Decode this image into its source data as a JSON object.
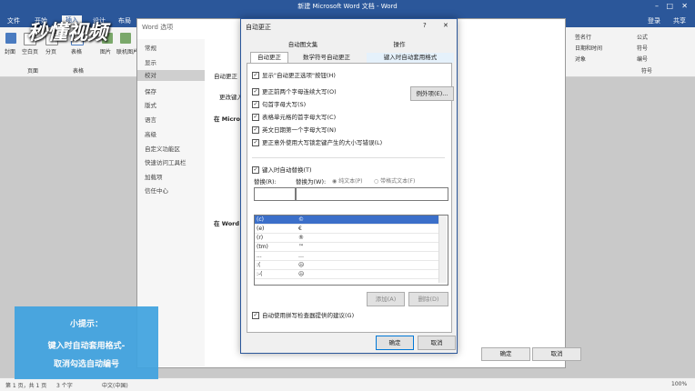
{
  "word": {
    "title": "新建 Microsoft Word 文档 - Word",
    "login": "登录",
    "share": "共享",
    "tabs": [
      "文件",
      "开始",
      "插入",
      "设计",
      "布局"
    ],
    "ribbon": {
      "groups": [
        "页面",
        "表格",
        "符号"
      ],
      "items": [
        "封面",
        "空白页",
        "分页",
        "表格",
        "图片",
        "联机图片"
      ],
      "right_items": [
        "签名行",
        "日期和时间",
        "对象",
        "公式",
        "符号",
        "编号"
      ],
      "status": [
        "第 1 页，共 1 页",
        "3 个字",
        "中文(中国)"
      ],
      "zoom": "100%"
    }
  },
  "options_dialog": {
    "title": "Word 选项",
    "nav": [
      "常规",
      "显示",
      "校对",
      "保存",
      "版式",
      "语言",
      "高级",
      "自定义功能区",
      "快速访问工具栏",
      "加载项",
      "信任中心"
    ],
    "selected_nav": "校对",
    "sections": [
      "自动更正",
      "更改键入",
      "在 Microsoft",
      "在 Word"
    ],
    "ok": "确定",
    "cancel": "取消"
  },
  "autocorrect": {
    "title": "自动更正",
    "help": "?",
    "tabs_top": [
      "自动图文集",
      "操作"
    ],
    "tabs_bottom": [
      "自动更正",
      "数学符号自动更正",
      "键入时自动套用格式"
    ],
    "active_tab": "自动更正",
    "options": [
      "显示\"自动更正选项\"按钮(H)",
      "更正前两个字母连续大写(O)",
      "句首字母大写(S)",
      "表格单元格的首字母大写(C)",
      "英文日期第一个字母大写(N)",
      "更正意外使用大写锁定键产生的大小写错误(L)"
    ],
    "exceptions_button": "例外项(E)...",
    "replace_as_typed": "键入时自动替换(T)",
    "replace_label": "替换(R):",
    "with_label": "替换为(W):",
    "plain_text": "纯文本(P)",
    "formatted_text": "带格式文本(F)",
    "entries": [
      {
        "from": "(c)",
        "to": "©"
      },
      {
        "from": "(e)",
        "to": "€"
      },
      {
        "from": "(r)",
        "to": "®"
      },
      {
        "from": "(tm)",
        "to": "™"
      },
      {
        "from": "...",
        "to": "…"
      },
      {
        "from": ":(",
        "to": "☹"
      },
      {
        "from": ":-(",
        "to": "☹"
      }
    ],
    "add_button": "添加(A)",
    "delete_button": "删除(D)",
    "spellcheck_option": "自动使用拼写检查器提供的建议(G)",
    "ok": "确定",
    "cancel": "取消"
  },
  "watermark": "秒懂视频",
  "tip": {
    "title": "小提示：",
    "line1": "键入时自动套用格式-",
    "line2": "取消勾选自动编号"
  },
  "colors": {
    "accent": "#2b579a",
    "tip": "#3fa3e0",
    "selection": "#3b6fc9"
  }
}
